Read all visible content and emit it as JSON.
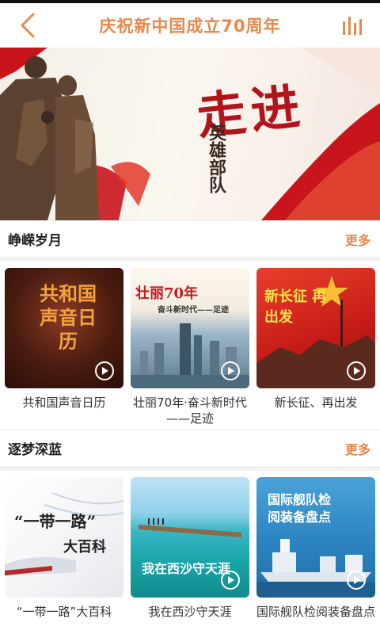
{
  "header": {
    "title": "庆祝新中国成立70周年",
    "back_icon": "chevron-left-icon",
    "stats_icon": "bar-chart-icon",
    "accent_color": "#e8884a"
  },
  "banner": {
    "main_text": "走进",
    "sub_text": "英雄部队"
  },
  "sections": [
    {
      "title": "峥嵘岁月",
      "more_label": "更多",
      "cards": [
        {
          "caption": "共和国声音日历",
          "thumb_text": "共和国声音日历",
          "has_play": true
        },
        {
          "caption": "壮丽70年·奋斗新时代——足迹",
          "thumb_text": "壮丽70年",
          "thumb_subtext": "奋斗新时代——足迹",
          "has_play": true
        },
        {
          "caption": "新长征、再出发",
          "thumb_text": "新长征 再出发",
          "has_play": true
        }
      ]
    },
    {
      "title": "逐梦深蓝",
      "more_label": "更多",
      "cards": [
        {
          "caption": "“一带一路”大百科",
          "thumb_text": "“一带一路”",
          "thumb_subtext": "大百科",
          "has_play": false
        },
        {
          "caption": "我在西沙守天涯",
          "thumb_text": "我在西沙守天涯",
          "has_play": true
        },
        {
          "caption": "国际舰队检阅装备盘点",
          "thumb_text": "国际舰队检阅装备盘点",
          "has_play": true
        }
      ]
    }
  ]
}
